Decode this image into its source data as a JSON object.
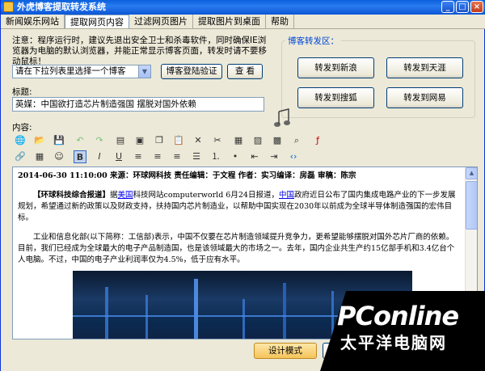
{
  "window": {
    "title": "外虎博客提取转发系统",
    "min": "_",
    "max": "□",
    "close": "×"
  },
  "menu": [
    {
      "label": "新闻娱乐网站"
    },
    {
      "label": "提取网页内容",
      "active": true
    },
    {
      "label": "过滤网页图片"
    },
    {
      "label": "提取图片到桌面"
    },
    {
      "label": "帮助"
    }
  ],
  "notice": "注意：程序运行时，建议先退出安全卫士和杀毒软件，同时确保IE浏览器为电脑的默认浏览器，并能正常显示博客页面，转发时请不要移动鼠标！",
  "blog_select": {
    "value": "请在下拉列表里选择一个博客"
  },
  "buttons": {
    "verify_login": "博客登陆验证",
    "view": "查 看",
    "design_mode": "设计模式"
  },
  "title_label": "标题:",
  "title_value": "英媒：中国欲打造芯片制造强国 摆脱对国外依赖",
  "forward_group": {
    "title": "博客转发区：",
    "buttons": [
      "转发到新浪",
      "转发到天涯",
      "转发到搜狐",
      "转发到网易"
    ]
  },
  "content_label": "内容:",
  "article": {
    "meta": "2014-06-30 11:10:00 来源：环球网科技 责任编辑：于文程 作者：实习编译：房磊 审稿：陈宗",
    "p1_a": "【环球科技综合报道】",
    "p1_b": "据",
    "p1_link1": "美国",
    "p1_c": "科技网站computerworld 6月24日报道，",
    "p1_link2": "中国",
    "p1_d": "政府近日公布了国内集成电路产业的下一步发展规划，希望通过新的政策以及财政支持，扶持国内芯片制造业，以帮助中国实现在2030年以前成为全球半导体制造强国的宏伟目标。",
    "p2": "工业和信息化部(以下简称：工信部)表示，中国不仅要在芯片制造领域提升竞争力，更希望能够摆脱对国外芯片厂商的依赖。目前，我们已经成为全球最大的电子产品制造国，也是该领域最大的市场之一。去年，国内企业共生产约15亿部手机和3.4亿台个人电脑。不过，中国的电子产业利润率仅为4.5%，低于应有水平。"
  },
  "watermark": {
    "brand": "PConline",
    "cn": "太平洋电脑网"
  },
  "colors": {
    "title_bar": "#0a5fdc",
    "group_title": "#0046d5",
    "design_btn": "#f5c45a"
  }
}
